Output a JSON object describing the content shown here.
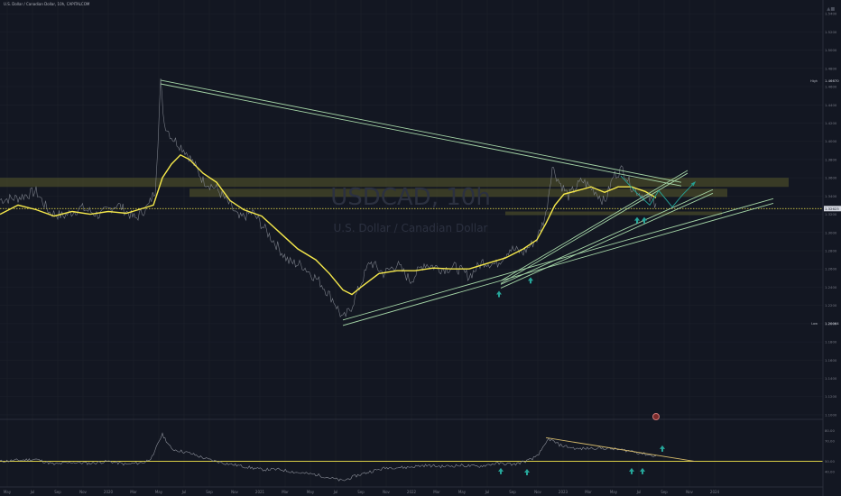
{
  "header": {
    "symbol_line": "U.S. Dollar / Canadian Dollar, 10h, CAPITALCOM"
  },
  "watermark": {
    "ticker": "USDCAD, 10h",
    "name": "U.S. Dollar / Canadian Dollar"
  },
  "colors": {
    "bg": "#131722",
    "price": "#8c909a",
    "ma": "#f6e94b",
    "trend": "#a5d6a7",
    "zone": "#5a5a2a",
    "arrow": "#26a69a",
    "dotted": "#f6e94b",
    "grid": "#1e222d"
  },
  "icons": [
    "tradingview-logo-icon",
    "alert-icon"
  ],
  "price_scale": {
    "labels": [
      "1.5400",
      "1.5200",
      "1.5000",
      "1.4800",
      "1.4600",
      "1.4400",
      "1.4200",
      "1.4000",
      "1.3800",
      "1.3600",
      "1.3400",
      "1.3200",
      "1.3000",
      "1.2800",
      "1.2600",
      "1.2400",
      "1.2200",
      "1.2000",
      "1.1800",
      "1.1600",
      "1.1400",
      "1.1200",
      "1.1000"
    ],
    "markers": [
      {
        "text": "High",
        "value": "1.46670",
        "y": 1.4667
      },
      {
        "text": "Low",
        "value": "1.20064",
        "y": 1.2006
      }
    ],
    "current": {
      "value": "1.32623",
      "y": 1.3262
    }
  },
  "rsi_scale": {
    "labels": [
      "80.00",
      "70.00",
      "50.00",
      "40.00"
    ]
  },
  "time_axis": {
    "labels": [
      "May",
      "Jul",
      "Sep",
      "Nov",
      "2020",
      "Mar",
      "May",
      "Jul",
      "Sep",
      "Nov",
      "2021",
      "Mar",
      "May",
      "Jul",
      "Sep",
      "Nov",
      "2022",
      "Mar",
      "May",
      "Jul",
      "Sep",
      "Nov",
      "2023",
      "Mar",
      "May",
      "Jul",
      "Sep",
      "Nov",
      "2024"
    ]
  },
  "chart_data": {
    "type": "line",
    "x_axis": "time",
    "price_range": [
      1.095,
      1.555
    ],
    "price_path": [
      [
        0,
        1.336
      ],
      [
        20,
        1.338
      ],
      [
        40,
        1.345
      ],
      [
        55,
        1.322
      ],
      [
        70,
        1.318
      ],
      [
        90,
        1.327
      ],
      [
        110,
        1.319
      ],
      [
        130,
        1.331
      ],
      [
        150,
        1.315
      ],
      [
        165,
        1.33
      ],
      [
        172,
        1.347
      ],
      [
        175,
        1.4
      ],
      [
        178,
        1.465
      ],
      [
        182,
        1.42
      ],
      [
        190,
        1.405
      ],
      [
        205,
        1.39
      ],
      [
        215,
        1.375
      ],
      [
        225,
        1.357
      ],
      [
        240,
        1.348
      ],
      [
        255,
        1.33
      ],
      [
        265,
        1.315
      ],
      [
        280,
        1.322
      ],
      [
        300,
        1.295
      ],
      [
        320,
        1.268
      ],
      [
        335,
        1.264
      ],
      [
        355,
        1.245
      ],
      [
        370,
        1.225
      ],
      [
        380,
        1.205
      ],
      [
        388,
        1.215
      ],
      [
        395,
        1.232
      ],
      [
        410,
        1.268
      ],
      [
        425,
        1.255
      ],
      [
        440,
        1.265
      ],
      [
        455,
        1.247
      ],
      [
        470,
        1.266
      ],
      [
        490,
        1.26
      ],
      [
        505,
        1.262
      ],
      [
        520,
        1.252
      ],
      [
        535,
        1.268
      ],
      [
        550,
        1.265
      ],
      [
        565,
        1.282
      ],
      [
        580,
        1.278
      ],
      [
        595,
        1.293
      ],
      [
        605,
        1.32
      ],
      [
        612,
        1.372
      ],
      [
        620,
        1.355
      ],
      [
        630,
        1.34
      ],
      [
        645,
        1.357
      ],
      [
        660,
        1.345
      ],
      [
        670,
        1.333
      ],
      [
        680,
        1.362
      ],
      [
        690,
        1.37
      ],
      [
        700,
        1.35
      ],
      [
        710,
        1.342
      ],
      [
        720,
        1.336
      ],
      [
        727,
        1.332
      ]
    ],
    "ma_path": [
      [
        0,
        1.32
      ],
      [
        20,
        1.33
      ],
      [
        40,
        1.325
      ],
      [
        60,
        1.318
      ],
      [
        80,
        1.323
      ],
      [
        100,
        1.32
      ],
      [
        120,
        1.323
      ],
      [
        140,
        1.321
      ],
      [
        160,
        1.327
      ],
      [
        170,
        1.33
      ],
      [
        180,
        1.36
      ],
      [
        190,
        1.375
      ],
      [
        200,
        1.385
      ],
      [
        210,
        1.38
      ],
      [
        225,
        1.365
      ],
      [
        240,
        1.355
      ],
      [
        255,
        1.335
      ],
      [
        270,
        1.325
      ],
      [
        290,
        1.318
      ],
      [
        310,
        1.3
      ],
      [
        330,
        1.282
      ],
      [
        350,
        1.27
      ],
      [
        365,
        1.255
      ],
      [
        380,
        1.237
      ],
      [
        390,
        1.232
      ],
      [
        400,
        1.24
      ],
      [
        420,
        1.255
      ],
      [
        440,
        1.258
      ],
      [
        460,
        1.258
      ],
      [
        480,
        1.261
      ],
      [
        500,
        1.26
      ],
      [
        520,
        1.26
      ],
      [
        540,
        1.266
      ],
      [
        560,
        1.272
      ],
      [
        580,
        1.282
      ],
      [
        595,
        1.292
      ],
      [
        605,
        1.31
      ],
      [
        615,
        1.33
      ],
      [
        625,
        1.342
      ],
      [
        640,
        1.346
      ],
      [
        655,
        1.35
      ],
      [
        670,
        1.344
      ],
      [
        685,
        1.35
      ],
      [
        700,
        1.35
      ],
      [
        715,
        1.345
      ],
      [
        727,
        1.338
      ]
    ],
    "trendlines": [
      {
        "from": [
          178,
          1.467
        ],
        "to": [
          755,
          1.355
        ]
      },
      {
        "from": [
          178,
          1.463
        ],
        "to": [
          755,
          1.351
        ]
      },
      {
        "from": [
          380,
          1.204
        ],
        "to": [
          857,
          1.337
        ]
      },
      {
        "from": [
          380,
          1.198
        ],
        "to": [
          857,
          1.332
        ]
      },
      {
        "from": [
          555,
          1.243
        ],
        "to": [
          790,
          1.347
        ]
      },
      {
        "from": [
          555,
          1.239
        ],
        "to": [
          790,
          1.343
        ]
      },
      {
        "from": [
          555,
          1.247
        ],
        "to": [
          762,
          1.368
        ]
      },
      {
        "from": [
          555,
          1.244
        ],
        "to": [
          762,
          1.365
        ]
      }
    ],
    "zones": [
      {
        "x": [
          0,
          874
        ],
        "y": [
          1.35,
          1.36
        ]
      },
      {
        "x": [
          210,
          806
        ],
        "y": [
          1.339,
          1.348
        ]
      },
      {
        "x": [
          560,
          800
        ],
        "y": [
          1.319,
          1.323
        ]
      }
    ],
    "horizontal_level": 1.3262,
    "projection": [
      [
        688,
        1.362
      ],
      [
        705,
        1.344
      ],
      [
        720,
        1.33
      ],
      [
        730,
        1.346
      ],
      [
        745,
        1.328
      ],
      [
        757,
        1.342
      ],
      [
        770,
        1.355
      ]
    ],
    "arrows_up": [
      [
        553,
        1.232
      ],
      [
        588,
        1.247
      ],
      [
        706,
        1.313
      ],
      [
        714,
        1.313
      ]
    ],
    "rsi": {
      "range": [
        25,
        90
      ],
      "path": [
        [
          0,
          50
        ],
        [
          20,
          51
        ],
        [
          40,
          52
        ],
        [
          60,
          47
        ],
        [
          80,
          49
        ],
        [
          100,
          48
        ],
        [
          120,
          50
        ],
        [
          140,
          47
        ],
        [
          160,
          49
        ],
        [
          170,
          55
        ],
        [
          175,
          68
        ],
        [
          180,
          76
        ],
        [
          190,
          62
        ],
        [
          210,
          58
        ],
        [
          230,
          52
        ],
        [
          250,
          48
        ],
        [
          270,
          45
        ],
        [
          290,
          42
        ],
        [
          310,
          42
        ],
        [
          330,
          39
        ],
        [
          350,
          37
        ],
        [
          370,
          33
        ],
        [
          380,
          31
        ],
        [
          395,
          36
        ],
        [
          410,
          40
        ],
        [
          430,
          44
        ],
        [
          450,
          44
        ],
        [
          470,
          46
        ],
        [
          490,
          45
        ],
        [
          510,
          46
        ],
        [
          530,
          45
        ],
        [
          550,
          48
        ],
        [
          570,
          47
        ],
        [
          590,
          52
        ],
        [
          600,
          60
        ],
        [
          608,
          72
        ],
        [
          620,
          66
        ],
        [
          640,
          62
        ],
        [
          660,
          63
        ],
        [
          680,
          62
        ],
        [
          700,
          60
        ],
        [
          720,
          56
        ],
        [
          727,
          55
        ]
      ],
      "trendline": {
        "from": [
          605,
          73
        ],
        "to": [
          770,
          50
        ]
      },
      "level": 50,
      "arrows_up": [
        [
          555,
          40
        ],
        [
          584,
          39
        ],
        [
          700,
          40
        ],
        [
          712,
          40
        ],
        [
          734,
          62
        ]
      ]
    }
  }
}
